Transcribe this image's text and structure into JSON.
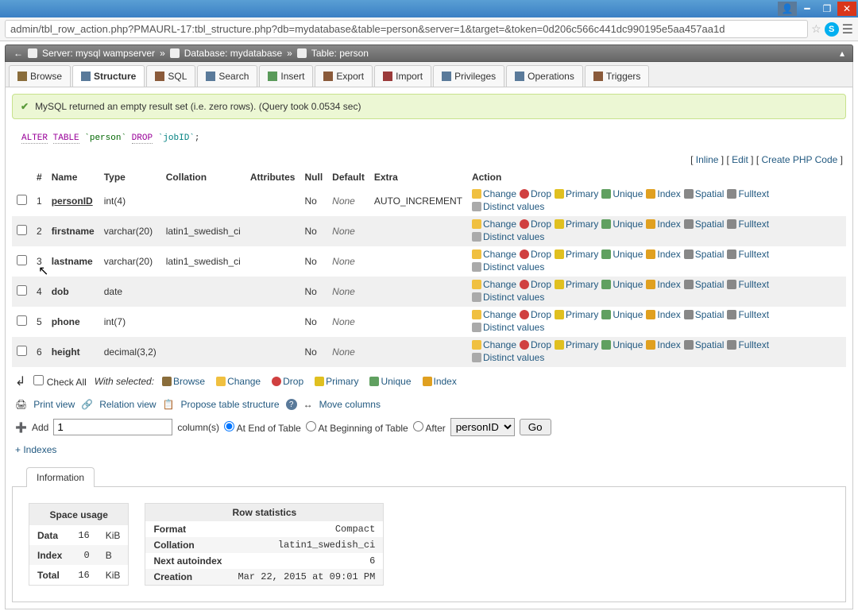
{
  "url": "admin/tbl_row_action.php?PMAURL-17:tbl_structure.php?db=mydatabase&table=person&server=1&target=&token=0d206c566c441dc990195e5aa457aa1d",
  "breadcrumb": {
    "server_label": "Server:",
    "server": "mysql wampserver",
    "db_label": "Database:",
    "db": "mydatabase",
    "table_label": "Table:",
    "table": "person"
  },
  "tabs": [
    {
      "label": "Browse",
      "color": "#8a6d3b"
    },
    {
      "label": "Structure",
      "color": "#5a7a9a",
      "active": true
    },
    {
      "label": "SQL",
      "color": "#8a5a3a"
    },
    {
      "label": "Search",
      "color": "#5a7a9a"
    },
    {
      "label": "Insert",
      "color": "#5a9a5a"
    },
    {
      "label": "Export",
      "color": "#8a5a3a"
    },
    {
      "label": "Import",
      "color": "#9a3a3a"
    },
    {
      "label": "Privileges",
      "color": "#5a7a9a"
    },
    {
      "label": "Operations",
      "color": "#5a7a9a"
    },
    {
      "label": "Triggers",
      "color": "#8a5a3a"
    }
  ],
  "message": "MySQL returned an empty result set (i.e. zero rows). (Query took 0.0534 sec)",
  "sql": {
    "alter": "ALTER",
    "table": "TABLE",
    "tbl": "`person`",
    "drop": "DROP",
    "col": "`jobID`",
    "end": ";"
  },
  "links": {
    "inline": "Inline",
    "edit": "Edit",
    "create": "Create PHP Code"
  },
  "headers": {
    "num": "#",
    "name": "Name",
    "type": "Type",
    "coll": "Collation",
    "attr": "Attributes",
    "null": "Null",
    "def": "Default",
    "extra": "Extra",
    "action": "Action"
  },
  "actions": {
    "change": "Change",
    "drop": "Drop",
    "primary": "Primary",
    "unique": "Unique",
    "index": "Index",
    "spatial": "Spatial",
    "fulltext": "Fulltext",
    "distinct": "Distinct values"
  },
  "columns": [
    {
      "n": "1",
      "name": "personID",
      "pk": true,
      "type": "int(4)",
      "coll": "",
      "null": "No",
      "def": "None",
      "extra": "AUTO_INCREMENT"
    },
    {
      "n": "2",
      "name": "firstname",
      "type": "varchar(20)",
      "coll": "latin1_swedish_ci",
      "null": "No",
      "def": "None",
      "extra": ""
    },
    {
      "n": "3",
      "name": "lastname",
      "type": "varchar(20)",
      "coll": "latin1_swedish_ci",
      "null": "No",
      "def": "None",
      "extra": ""
    },
    {
      "n": "4",
      "name": "dob",
      "type": "date",
      "coll": "",
      "null": "No",
      "def": "None",
      "extra": ""
    },
    {
      "n": "5",
      "name": "phone",
      "type": "int(7)",
      "coll": "",
      "null": "No",
      "def": "None",
      "extra": ""
    },
    {
      "n": "6",
      "name": "height",
      "type": "decimal(3,2)",
      "coll": "",
      "null": "No",
      "def": "None",
      "extra": ""
    }
  ],
  "tools": {
    "checkall": "Check All",
    "withsel": "With selected:",
    "browse": "Browse",
    "change": "Change",
    "drop": "Drop",
    "primary": "Primary",
    "unique": "Unique",
    "index": "Index"
  },
  "footer": {
    "print": "Print view",
    "relation": "Relation view",
    "propose": "Propose table structure",
    "move": "Move columns"
  },
  "add": {
    "label": "Add",
    "value": "1",
    "colslabel": "column(s)",
    "end": "At End of Table",
    "begin": "At Beginning of Table",
    "after": "After",
    "aftercol": "personID",
    "go": "Go"
  },
  "indexes": "+ Indexes",
  "info_tab": "Information",
  "space": {
    "title": "Space usage",
    "rows": [
      {
        "l": "Data",
        "v": "16",
        "u": "KiB"
      },
      {
        "l": "Index",
        "v": "0",
        "u": "B"
      },
      {
        "l": "Total",
        "v": "16",
        "u": "KiB"
      }
    ]
  },
  "rowstat": {
    "title": "Row statistics",
    "rows": [
      {
        "l": "Format",
        "v": "Compact"
      },
      {
        "l": "Collation",
        "v": "latin1_swedish_ci"
      },
      {
        "l": "Next autoindex",
        "v": "6"
      },
      {
        "l": "Creation",
        "v": "Mar 22, 2015 at 09:01 PM"
      }
    ]
  }
}
